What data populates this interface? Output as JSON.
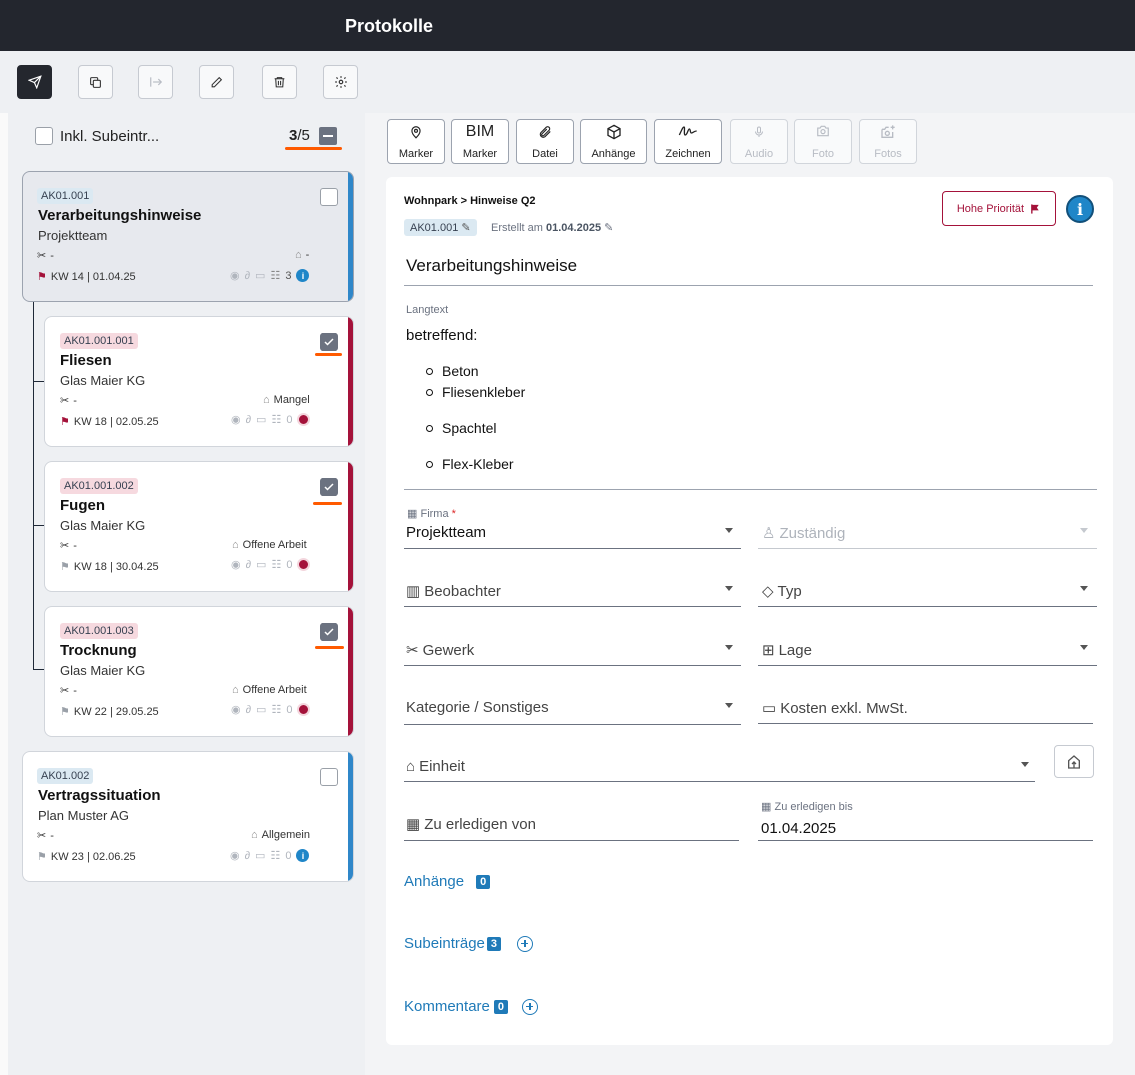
{
  "app": {
    "title": "Protokolle"
  },
  "toolbar": {
    "buttons": [
      {
        "icon": "send-icon",
        "state": "active"
      },
      {
        "icon": "copy-icon",
        "state": "normal"
      },
      {
        "icon": "move-icon",
        "state": "disabled"
      },
      {
        "icon": "edit-icon",
        "state": "normal"
      },
      {
        "icon": "trash-icon",
        "state": "normal"
      },
      {
        "icon": "gear-icon",
        "state": "normal"
      }
    ]
  },
  "list": {
    "include_label": "Inkl. Subeintr...",
    "counter_selected": "3",
    "counter_total": "/5",
    "cards": [
      {
        "code": "AK01.001",
        "title": "Verarbeitungshinweise",
        "company": "Projektteam",
        "trade": "-",
        "tag": "-",
        "week": "KW 14 | 01.04.25",
        "sub_count": "3",
        "status": "info",
        "checked": false,
        "color": "#2f87c9"
      },
      {
        "code": "AK01.001.001",
        "title": "Fliesen",
        "company": "Glas Maier KG",
        "trade": "-",
        "tag": "Mangel",
        "week": "KW 18 | 02.05.25",
        "sub_count": "0",
        "status": "red",
        "checked": true,
        "color": "#a4123a"
      },
      {
        "code": "AK01.001.002",
        "title": "Fugen",
        "company": "Glas Maier KG",
        "trade": "-",
        "tag": "Offene Arbeit",
        "week": "KW 18 | 30.04.25",
        "sub_count": "0",
        "status": "red",
        "checked": true,
        "color": "#a4123a"
      },
      {
        "code": "AK01.001.003",
        "title": "Trocknung",
        "company": "Glas Maier KG",
        "trade": "-",
        "tag": "Offene Arbeit",
        "week": "KW 22 | 29.05.25",
        "sub_count": "0",
        "status": "red",
        "checked": true,
        "color": "#a4123a"
      },
      {
        "code": "AK01.002",
        "title": "Vertragssituation",
        "company": "Plan Muster AG",
        "trade": "-",
        "tag": "Allgemein",
        "week": "KW 23 | 02.06.25",
        "sub_count": "0",
        "status": "info",
        "checked": false,
        "color": "#2f87c9"
      }
    ]
  },
  "attachments_bar": [
    {
      "label": "Marker",
      "icon": "map-pin-icon"
    },
    {
      "label": "Marker",
      "icon": "BIM"
    },
    {
      "label": "Datei",
      "icon": "paperclip-icon"
    },
    {
      "label": "Anhänge",
      "icon": "box-icon"
    },
    {
      "label": "Zeichnen",
      "icon": "signature-icon"
    },
    {
      "label": "Audio",
      "icon": "microphone-icon"
    },
    {
      "label": "Foto",
      "icon": "camera-icon"
    },
    {
      "label": "Fotos",
      "icon": "camera-plus-icon"
    }
  ],
  "detail": {
    "breadcrumb": "Wohnpark > Hinweise Q2",
    "code": "AK01.001",
    "created_prefix": "Erstellt am ",
    "created_date": "01.04.2025",
    "priority_label": "Hohe Priorität",
    "title": "Verarbeitungshinweise",
    "longtext_label": "Langtext",
    "longtext_intro": "betreffend:",
    "longtext_items": [
      "Beton",
      "Fliesenkleber",
      "Spachtel",
      "Flex-Kleber"
    ],
    "fields": {
      "firma_label": "Firma",
      "firma_value": "Projektteam",
      "zustaendig": "Zuständig",
      "beobachter": "Beobachter",
      "typ": "Typ",
      "gewerk": "Gewerk",
      "lage": "Lage",
      "kategorie": "Kategorie / Sonstiges",
      "kosten": "Kosten exkl. MwSt.",
      "einheit": "Einheit",
      "von": "Zu erledigen von",
      "bis_label": "Zu erledigen bis",
      "bis_value": "01.04.2025"
    },
    "sections": {
      "anhaenge_label": "Anhänge",
      "anhaenge_count": "0",
      "sub_label": "Subeinträge",
      "sub_count": "3",
      "komm_label": "Kommentare",
      "komm_count": "0"
    }
  }
}
